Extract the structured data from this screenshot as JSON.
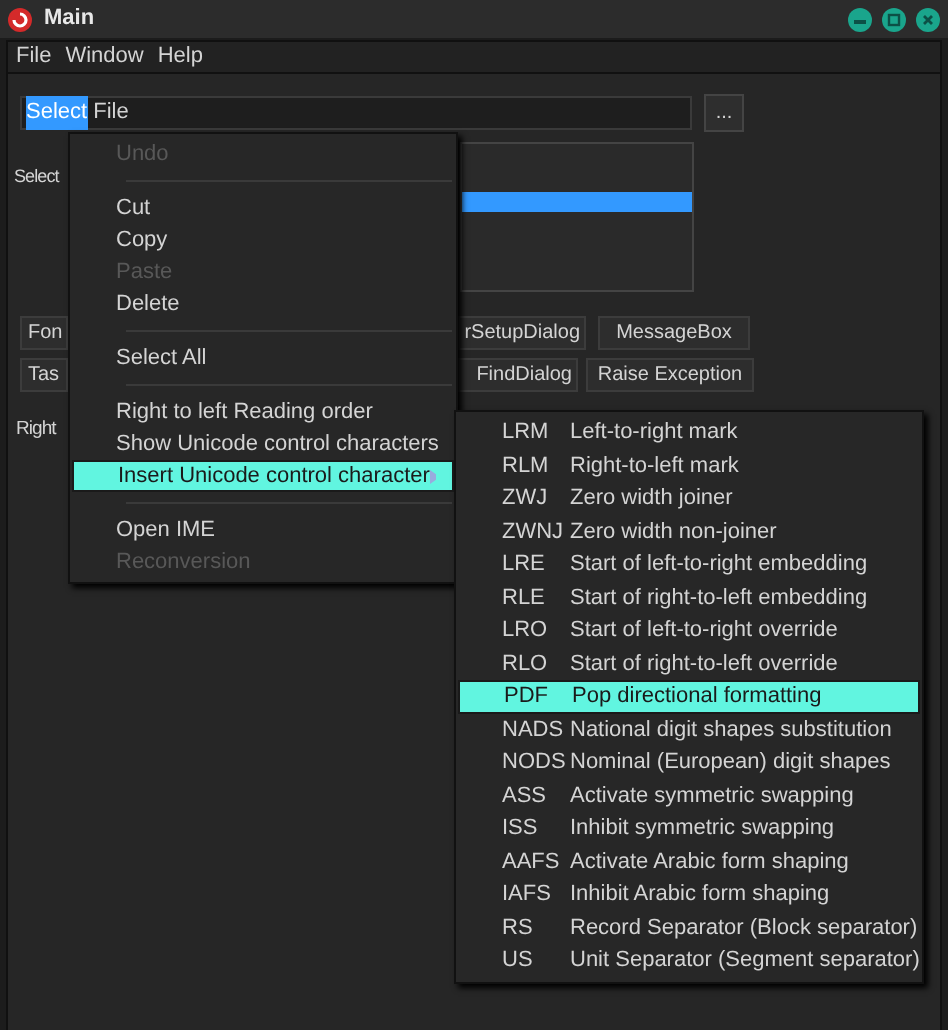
{
  "window": {
    "title": "Main"
  },
  "menu_bar": [
    {
      "label": "File"
    },
    {
      "label": "Window"
    },
    {
      "label": "Help"
    }
  ],
  "file_field": {
    "selected_text": "Select",
    "value": " File"
  },
  "browse_button": "...",
  "list_label": "Select",
  "list": {
    "rows": [
      {
        "selected": false
      },
      {
        "selected": false
      },
      {
        "selected": true
      },
      {
        "selected": false
      },
      {
        "selected": false
      }
    ]
  },
  "button_rows": [
    [
      "Fon",
      "rSetupDialog",
      "MessageBox"
    ],
    [
      "Tas",
      "FindDialog",
      "Raise Exception"
    ]
  ],
  "bottom_label": "Right",
  "context_menu": [
    {
      "kind": "item",
      "label": "Undo",
      "disabled": true,
      "selected": false
    },
    {
      "kind": "separator"
    },
    {
      "kind": "item",
      "label": "Cut",
      "disabled": false,
      "selected": false
    },
    {
      "kind": "item",
      "label": "Copy",
      "disabled": false,
      "selected": false
    },
    {
      "kind": "item",
      "label": "Paste",
      "disabled": true,
      "selected": false
    },
    {
      "kind": "item",
      "label": "Delete",
      "disabled": false,
      "selected": false
    },
    {
      "kind": "separator"
    },
    {
      "kind": "item",
      "label": "Select All",
      "disabled": false,
      "selected": false
    },
    {
      "kind": "separator"
    },
    {
      "kind": "item",
      "label": "Right to left Reading order",
      "disabled": false,
      "selected": false
    },
    {
      "kind": "item",
      "label": "Show Unicode control characters",
      "disabled": false,
      "selected": false
    },
    {
      "kind": "submenu",
      "label": "Insert Unicode control character",
      "disabled": false,
      "selected": true
    },
    {
      "kind": "separator"
    },
    {
      "kind": "item",
      "label": "Open IME",
      "disabled": false,
      "selected": false
    },
    {
      "kind": "item",
      "label": "Reconversion",
      "disabled": true,
      "selected": false
    }
  ],
  "submenu": [
    {
      "code": "LRM",
      "label": "Left-to-right mark",
      "selected": false
    },
    {
      "code": "RLM",
      "label": "Right-to-left mark",
      "selected": false
    },
    {
      "code": "ZWJ",
      "label": "Zero width joiner",
      "selected": false
    },
    {
      "code": "ZWNJ",
      "label": "Zero width non-joiner",
      "selected": false
    },
    {
      "code": "LRE",
      "label": "Start of left-to-right embedding",
      "selected": false
    },
    {
      "code": "RLE",
      "label": "Start of right-to-left embedding",
      "selected": false
    },
    {
      "code": "LRO",
      "label": "Start of left-to-right override",
      "selected": false
    },
    {
      "code": "RLO",
      "label": "Start of right-to-left override",
      "selected": false
    },
    {
      "code": "PDF",
      "label": "Pop directional formatting",
      "selected": true
    },
    {
      "code": "NADS",
      "label": "National digit shapes substitution",
      "selected": false
    },
    {
      "code": "NODS",
      "label": "Nominal (European) digit shapes",
      "selected": false
    },
    {
      "code": "ASS",
      "label": "Activate symmetric swapping",
      "selected": false
    },
    {
      "code": "ISS",
      "label": "Inhibit symmetric swapping",
      "selected": false
    },
    {
      "code": "AAFS",
      "label": "Activate Arabic form shaping",
      "selected": false
    },
    {
      "code": "IAFS",
      "label": "Inhibit Arabic form shaping",
      "selected": false
    },
    {
      "code": "RS",
      "label": "Record Separator (Block separator)",
      "selected": false
    },
    {
      "code": "US",
      "label": "Unit Separator (Segment separator)",
      "selected": false
    }
  ]
}
